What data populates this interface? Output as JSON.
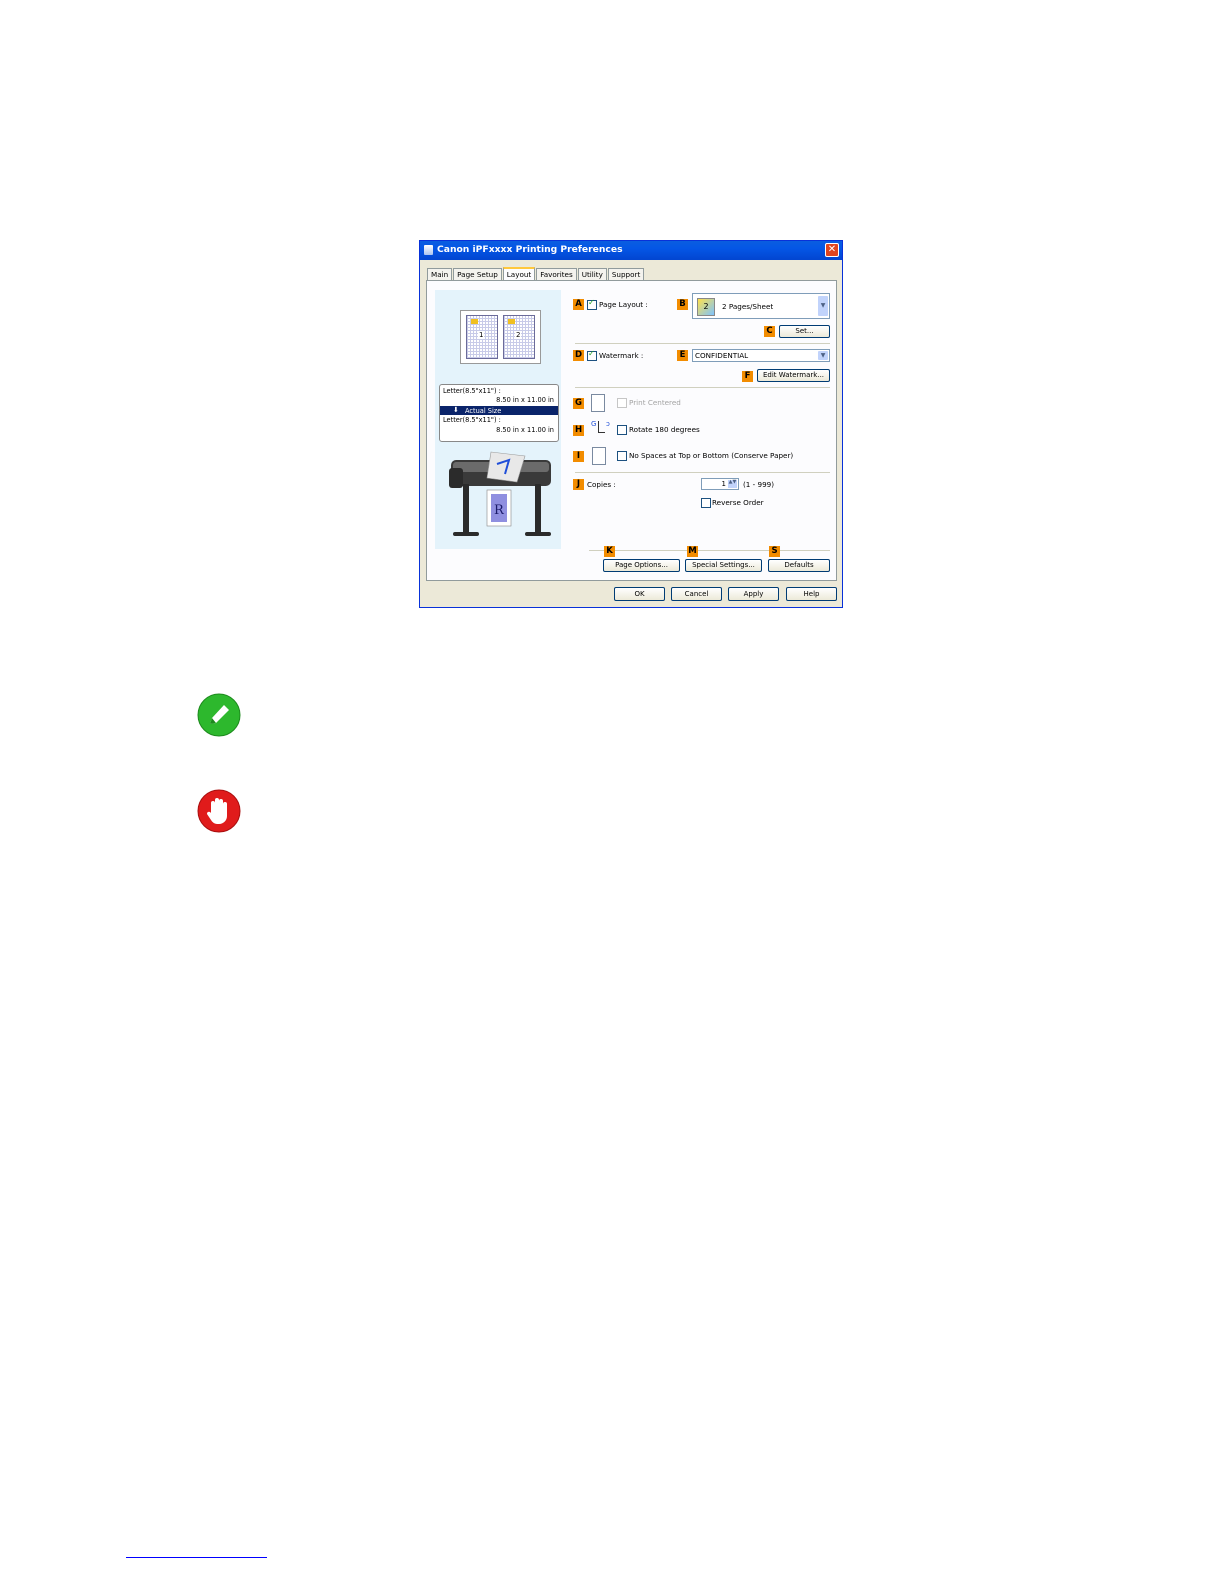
{
  "dialog": {
    "title": "Canon iPFxxxx Printing Preferences",
    "close": "✕",
    "tabs": [
      "Main",
      "Page Setup",
      "Layout",
      "Favorites",
      "Utility",
      "Support"
    ],
    "active_tab": "Layout"
  },
  "preview": {
    "page_numbers": [
      "1",
      "2"
    ],
    "info": {
      "input_paper": "Letter(8.5\"x11\") :",
      "input_size": "8.50 in x 11.00 in",
      "scale_mode": "Actual Size",
      "output_paper": "Letter(8.5\"x11\") :",
      "output_size": "8.50 in x 11.00 in"
    },
    "output_letter": "R"
  },
  "labels": {
    "A": "A",
    "B": "B",
    "C": "C",
    "D": "D",
    "E": "E",
    "F": "F",
    "G": "G",
    "H": "H",
    "I": "I",
    "J": "J",
    "K": "K",
    "M": "M",
    "S": "S"
  },
  "controls": {
    "page_layout_label": "Page Layout :",
    "page_layout_checked": true,
    "page_layout_value": "2 Pages/Sheet",
    "page_layout_icon_text": "2",
    "set_button": "Set...",
    "watermark_label": "Watermark :",
    "watermark_checked": true,
    "watermark_value": "CONFIDENTIAL",
    "edit_watermark_button": "Edit Watermark...",
    "print_centered_label": "Print Centered",
    "print_centered_enabled": false,
    "rotate_label": "Rotate 180 degrees",
    "rotate_checked": false,
    "no_spaces_label": "No Spaces at Top or Bottom (Conserve Paper)",
    "no_spaces_checked": false,
    "copies_label": "Copies :",
    "copies_value": "1",
    "copies_range": "(1 - 999)",
    "reverse_order_label": "Reverse Order",
    "reverse_order_checked": false,
    "page_options_button": "Page Options...",
    "special_settings_button": "Special Settings...",
    "defaults_button": "Defaults"
  },
  "footer": {
    "ok": "OK",
    "cancel": "Cancel",
    "apply": "Apply",
    "help": "Help"
  },
  "colors": {
    "label_accent": "#f28c00",
    "titlebar": "#0456e6",
    "note_icon": "#2db82d",
    "important_icon": "#e01b1b"
  },
  "doc_icons": [
    "pencil-icon",
    "stop-hand-icon"
  ]
}
